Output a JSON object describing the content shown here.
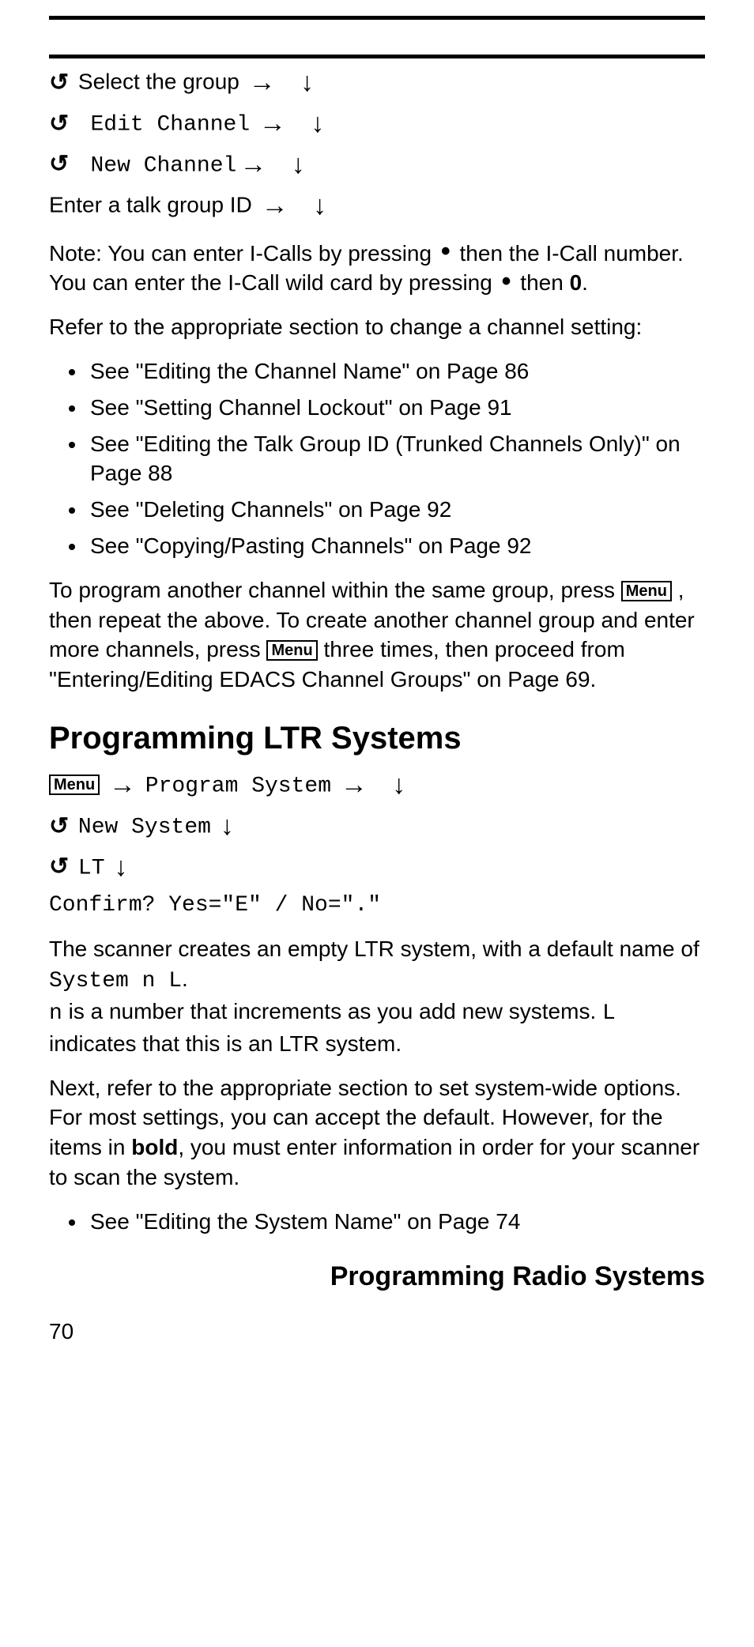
{
  "glyphs": {
    "rotate": "↺",
    "arrow_right": "→",
    "arrow_down": "↓",
    "dot": "•"
  },
  "keycap": {
    "menu": "Menu"
  },
  "steps_top": {
    "l1": "Select the group",
    "l2": "Edit Channel",
    "l3": "New Channel",
    "l4": "Enter a talk group ID"
  },
  "note": {
    "t1": "Note: You can enter I-Calls by pressing ",
    "t2": " then the I-Call number.  You can enter the I-Call wild card by pressing ",
    "t3": " then ",
    "zero": "0",
    "t4": "."
  },
  "refer1": "Refer to the appropriate section to change a channel setting:",
  "list1": [
    "See \"Editing the Channel Name\" on Page 86",
    "See \"Setting Channel Lockout\" on Page 91",
    "See \"Editing the Talk Group ID (Trunked Channels Only)\" on Page 88",
    "See \"Deleting Channels\" on Page 92",
    "See \"Copying/Pasting Channels\" on Page 92"
  ],
  "para2": {
    "t1": "To program another channel within the same group, press ",
    "t2": " , then repeat the above. To create another channel group and enter more channels, press ",
    "t3": " three times, then proceed from \"Entering/Editing EDACS Channel Groups\" on Page 69."
  },
  "heading": "Programming LTR Systems",
  "steps_ltr": {
    "l1": "Program System",
    "l2": "New System",
    "l3": "LT",
    "l4": "Confirm? Yes=\"E\" / No=\".\""
  },
  "para3": {
    "t1": "The scanner creates an empty LTR system, with a default name of ",
    "sys": "System n        L",
    "t2": ".",
    "n": "n",
    "t3": " is a number that increments as you add new systems. ",
    "L": "L",
    "t4": " indicates that this is an LTR system."
  },
  "para4": {
    "t1": "Next, refer to the appropriate section to set system-wide options. For most settings, you can accept the default. However, for the items in ",
    "bold": "bold",
    "t2": ", you must enter information in order for your scanner to scan the system."
  },
  "list2": [
    "See \"Editing the System Name\" on Page 74"
  ],
  "footer": "Programming Radio Systems",
  "page_number": "70"
}
